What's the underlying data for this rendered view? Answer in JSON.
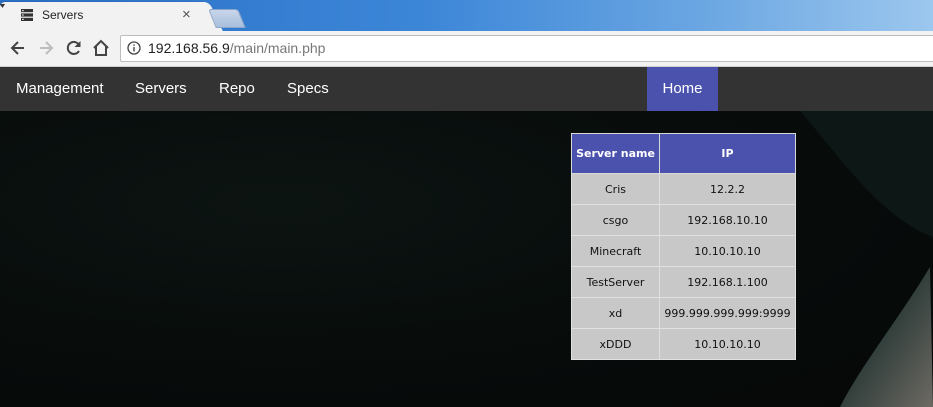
{
  "browser": {
    "tab_title": "Servers",
    "tab_close": "×",
    "address_host": "192.168.56.9",
    "address_path": "/main/main.php"
  },
  "navbar": {
    "items": [
      "Management",
      "Servers",
      "Repo",
      "Specs"
    ],
    "home": "Home",
    "active_color": "#4a52ad"
  },
  "table": {
    "headers": [
      "Server name",
      "IP"
    ],
    "rows": [
      [
        "Cris",
        "12.2.2"
      ],
      [
        "csgo",
        "192.168.10.10"
      ],
      [
        "Minecraft",
        "10.10.10.10"
      ],
      [
        "TestServer",
        "192.168.1.100"
      ],
      [
        "xd",
        "999.999.999.999:9999"
      ],
      [
        "xDDD",
        "10.10.10.10"
      ]
    ]
  },
  "icons": {
    "favicon": "server-icon",
    "back": "arrow-left-icon",
    "forward": "arrow-right-icon",
    "reload": "reload-icon",
    "home": "home-icon",
    "info": "info-icon"
  }
}
